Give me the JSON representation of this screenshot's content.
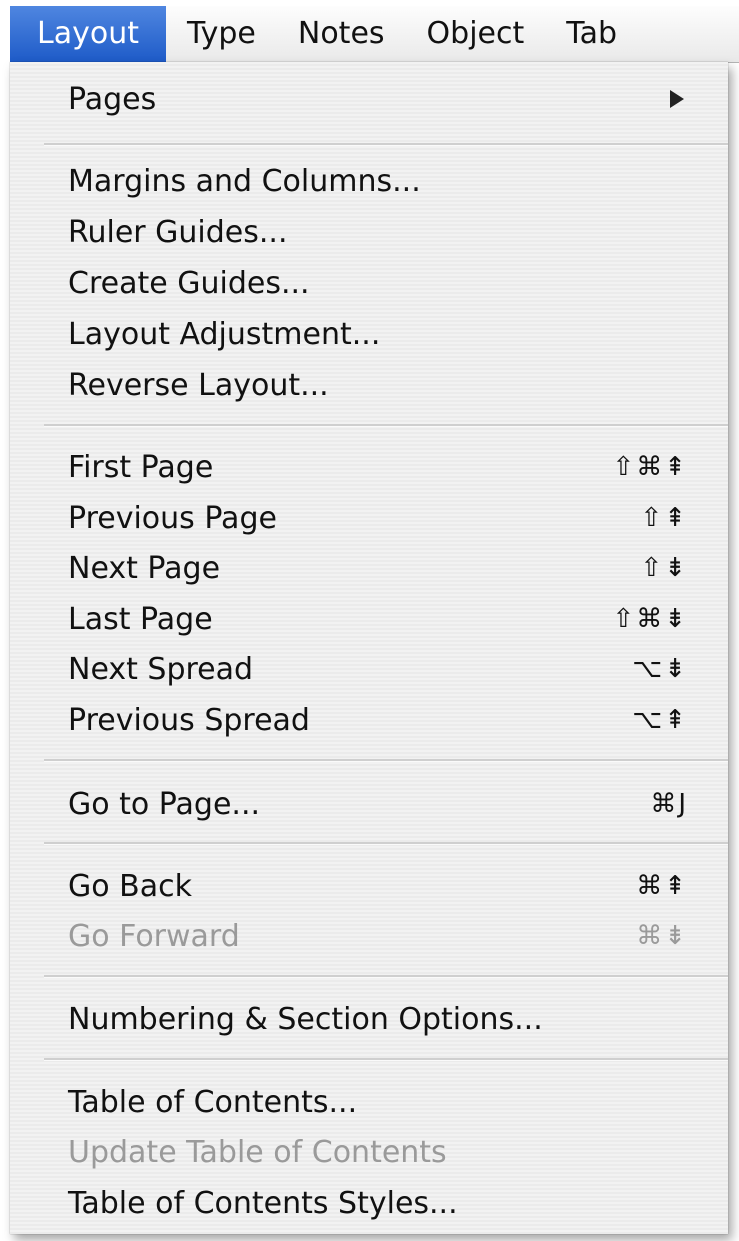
{
  "menubar": {
    "items": [
      "Layout",
      "Type",
      "Notes",
      "Object",
      "Tab"
    ]
  },
  "menu": {
    "pages": {
      "label": "Pages"
    },
    "margins_columns": {
      "label": "Margins and Columns..."
    },
    "ruler_guides": {
      "label": "Ruler Guides..."
    },
    "create_guides": {
      "label": "Create Guides..."
    },
    "layout_adjustment": {
      "label": "Layout Adjustment..."
    },
    "reverse_layout": {
      "label": "Reverse Layout..."
    },
    "first_page": {
      "label": "First Page",
      "shortcut": "⇧⌘⇞"
    },
    "previous_page": {
      "label": "Previous Page",
      "shortcut": "⇧⇞"
    },
    "next_page": {
      "label": "Next Page",
      "shortcut": "⇧⇟"
    },
    "last_page": {
      "label": "Last Page",
      "shortcut": "⇧⌘⇟"
    },
    "next_spread": {
      "label": "Next Spread",
      "shortcut": "⌥⇟"
    },
    "previous_spread": {
      "label": "Previous Spread",
      "shortcut": "⌥⇞"
    },
    "go_to_page": {
      "label": "Go to Page...",
      "shortcut": "⌘J"
    },
    "go_back": {
      "label": "Go Back",
      "shortcut": "⌘⇞"
    },
    "go_forward": {
      "label": "Go Forward",
      "shortcut": "⌘⇟"
    },
    "numbering_section": {
      "label": "Numbering & Section Options..."
    },
    "toc": {
      "label": "Table of Contents..."
    },
    "update_toc": {
      "label": "Update Table of Contents"
    },
    "toc_styles": {
      "label": "Table of Contents Styles..."
    }
  }
}
